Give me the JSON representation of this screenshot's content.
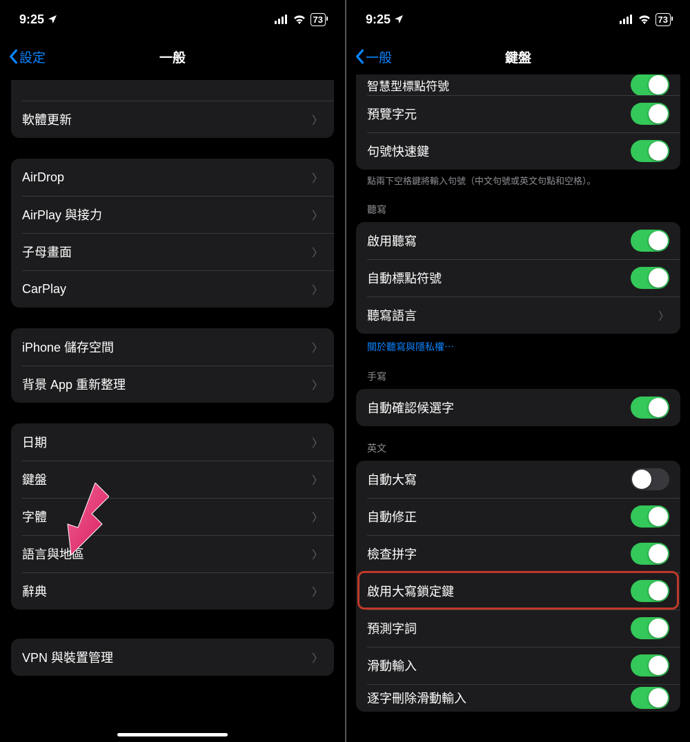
{
  "status": {
    "time": "9:25",
    "battery": "73"
  },
  "left": {
    "back": "設定",
    "title": "一般",
    "group1": [
      {
        "label": "軟體更新"
      }
    ],
    "group2": [
      {
        "label": "AirDrop"
      },
      {
        "label": "AirPlay 與接力"
      },
      {
        "label": "子母畫面"
      },
      {
        "label": "CarPlay"
      }
    ],
    "group3": [
      {
        "label": "iPhone 儲存空間"
      },
      {
        "label": "背景 App 重新整理"
      }
    ],
    "group4": [
      {
        "label": "日期"
      },
      {
        "label": "鍵盤"
      },
      {
        "label": "字體"
      },
      {
        "label": "語言與地區"
      },
      {
        "label": "辭典"
      }
    ],
    "group5": [
      {
        "label": "VPN 與裝置管理"
      }
    ]
  },
  "right": {
    "back": "一般",
    "title": "鍵盤",
    "group_top": [
      {
        "label": "智慧型標點符號",
        "on": true
      },
      {
        "label": "預覽字元",
        "on": true
      },
      {
        "label": "句號快速鍵",
        "on": true
      }
    ],
    "top_footnote": "點兩下空格鍵將輸入句號（中文句號或英文句點和空格）。",
    "header_dictation": "聽寫",
    "group_dictation": [
      {
        "label": "啟用聽寫",
        "on": true
      },
      {
        "label": "自動標點符號",
        "on": true
      },
      {
        "label": "聽寫語言",
        "nav": true
      }
    ],
    "dictation_link": "關於聽寫與隱私權⋯",
    "header_handwrite": "手寫",
    "group_handwrite": [
      {
        "label": "自動確認候選字",
        "on": true
      }
    ],
    "header_english": "英文",
    "group_english": [
      {
        "label": "自動大寫",
        "on": false
      },
      {
        "label": "自動修正",
        "on": true
      },
      {
        "label": "檢查拼字",
        "on": true
      },
      {
        "label": "啟用大寫鎖定鍵",
        "on": true,
        "highlight": true
      },
      {
        "label": "預測字詞",
        "on": true
      },
      {
        "label": "滑動輸入",
        "on": true
      },
      {
        "label": "逐字刪除滑動輸入",
        "on": true
      }
    ]
  }
}
